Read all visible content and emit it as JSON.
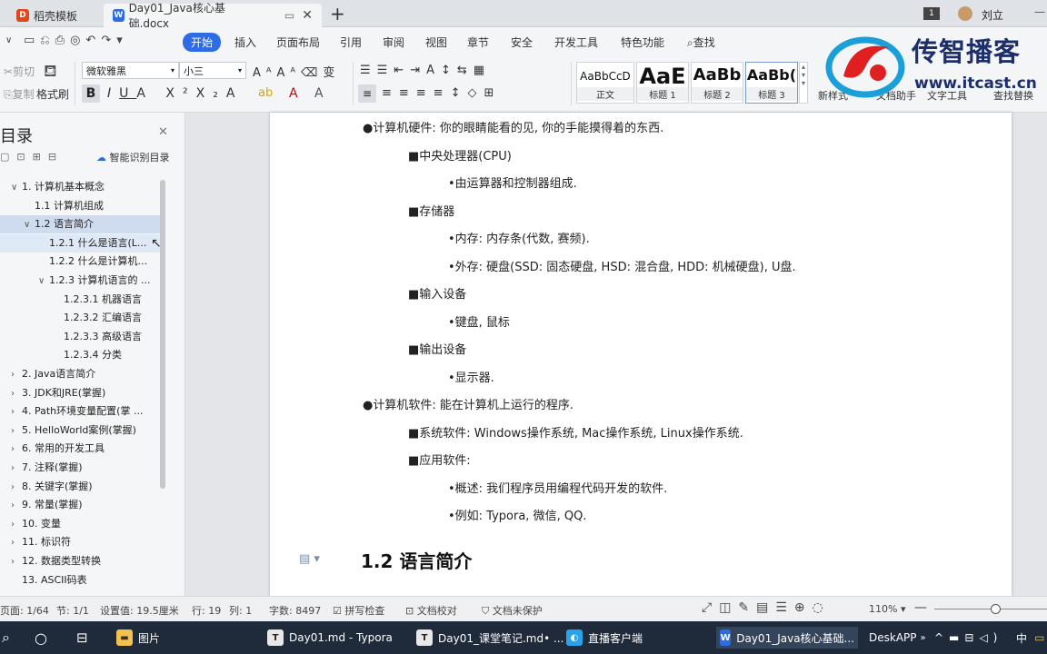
{
  "tabs": [
    {
      "label": "稻壳模板",
      "icon": "docer-icon"
    },
    {
      "label": "Day01_Java核心基础.docx",
      "icon": "word-doc-icon"
    }
  ],
  "user": {
    "name": "刘立",
    "page_badge": "1"
  },
  "menu": {
    "start": "开始",
    "items": [
      "插入",
      "页面布局",
      "引用",
      "审阅",
      "视图",
      "章节",
      "安全",
      "开发工具",
      "特色功能"
    ],
    "search": "查找"
  },
  "toolbar": {
    "cut": "剪切",
    "copy": "复制",
    "format_painter": "格式刷",
    "font": "微软雅黑",
    "size": "小三",
    "new_style": "新样式",
    "doc_helper": "文档助手",
    "text_tools": "文字工具",
    "find_replace": "查找替换",
    "styles": [
      {
        "sample": "AaBbCcD",
        "caption": "正文"
      },
      {
        "sample": "AaE",
        "caption": "标题 1"
      },
      {
        "sample": "AaBb",
        "caption": "标题 2"
      },
      {
        "sample": "AaBb(",
        "caption": "标题 3"
      }
    ]
  },
  "sidebar": {
    "title": "目录",
    "smart_label": "智能识别目录",
    "items": [
      {
        "label": "1. 计算机基本概念",
        "level": 0,
        "caret": "v"
      },
      {
        "label": "1.1 计算机组成",
        "level": 1,
        "caret": ""
      },
      {
        "label": "1.2 语言简介",
        "level": 1,
        "caret": "v"
      },
      {
        "label": "1.2.1 什么是语言(L...",
        "level": 2,
        "caret": ""
      },
      {
        "label": "1.2.2 什么是计算机...",
        "level": 2,
        "caret": ""
      },
      {
        "label": "1.2.3 计算机语言的 ...",
        "level": 2,
        "caret": "v"
      },
      {
        "label": "1.2.3.1 机器语言",
        "level": 3,
        "caret": ""
      },
      {
        "label": "1.2.3.2 汇编语言",
        "level": 3,
        "caret": ""
      },
      {
        "label": "1.2.3.3 高级语言",
        "level": 3,
        "caret": ""
      },
      {
        "label": "1.2.3.4 分类",
        "level": 3,
        "caret": ""
      },
      {
        "label": "2. Java语言简介",
        "level": 0,
        "caret": ">"
      },
      {
        "label": "3. JDK和JRE(掌握)",
        "level": 0,
        "caret": ">"
      },
      {
        "label": "4. Path环境变量配置(掌 ...",
        "level": 0,
        "caret": ">"
      },
      {
        "label": "5. HelloWorld案例(掌握)",
        "level": 0,
        "caret": ">"
      },
      {
        "label": "6. 常用的开发工具",
        "level": 0,
        "caret": ">"
      },
      {
        "label": "7. 注释(掌握)",
        "level": 0,
        "caret": ">"
      },
      {
        "label": "8. 关键字(掌握)",
        "level": 0,
        "caret": ">"
      },
      {
        "label": "9. 常量(掌握)",
        "level": 0,
        "caret": ">"
      },
      {
        "label": "10. 变量",
        "level": 0,
        "caret": ">"
      },
      {
        "label": "11. 标识符",
        "level": 0,
        "caret": ">"
      },
      {
        "label": "12. 数据类型转换",
        "level": 0,
        "caret": ">"
      },
      {
        "label": "13. ASCII码表",
        "level": 0,
        "caret": ""
      }
    ]
  },
  "document": {
    "lines": [
      {
        "text": "●计算机硬件: 你的眼睛能看的见, 你的手能摸得着的东西.",
        "indent": 0
      },
      {
        "text": "■中央处理器(CPU)",
        "indent": 1
      },
      {
        "text": "•由运算器和控制器组成.",
        "indent": 2
      },
      {
        "text": "■存储器",
        "indent": 1
      },
      {
        "text": "•内存: 内存条(代数, 赛频).",
        "indent": 2
      },
      {
        "text": "•外存: 硬盘(SSD: 固态硬盘, HSD: 混合盘, HDD: 机械硬盘), U盘.",
        "indent": 2
      },
      {
        "text": "■输入设备",
        "indent": 1
      },
      {
        "text": "•键盘, 鼠标",
        "indent": 2
      },
      {
        "text": "■输出设备",
        "indent": 1
      },
      {
        "text": "•显示器.",
        "indent": 2
      },
      {
        "text": "●计算机软件: 能在计算机上运行的程序.",
        "indent": 0
      },
      {
        "text": "■系统软件: Windows操作系统, Mac操作系统, Linux操作系统.",
        "indent": 1
      },
      {
        "text": "■应用软件:",
        "indent": 1
      },
      {
        "text": "•概述: 我们程序员用编程代码开发的软件.",
        "indent": 2
      },
      {
        "text": "•例如: Typora, 微信, QQ.",
        "indent": 2
      }
    ],
    "heading": "1.2 语言简介"
  },
  "status": {
    "page": "页面: 1/64",
    "section": "节: 1/1",
    "setting": "设置值: 19.5厘米",
    "row": "行: 19",
    "col": "列: 1",
    "words": "字数: 8497",
    "spell": "拼写检查",
    "proof": "文档校对",
    "protect": "文档未保护",
    "zoom": "110%",
    "zoom_level": 0.55
  },
  "taskbar": {
    "items": [
      {
        "label": "图片",
        "icon": "folder-icon"
      },
      {
        "label": "Day01.md - Typora",
        "icon": "typora-icon"
      },
      {
        "label": "Day01_课堂笔记.md• ...",
        "icon": "typora-icon"
      },
      {
        "label": "直播客户端",
        "icon": "live-client-icon"
      },
      {
        "label": "Day01_Java核心基础...",
        "icon": "wps-writer-icon"
      }
    ],
    "desk_app": "DeskAPP",
    "ime": "中"
  },
  "watermark": {
    "brand": "传智播客",
    "url": "www.itcast.cn"
  },
  "colors": {
    "accent": "#2e6ce6",
    "selected": "#cfdcef",
    "taskbar": "#1f2a3a"
  }
}
